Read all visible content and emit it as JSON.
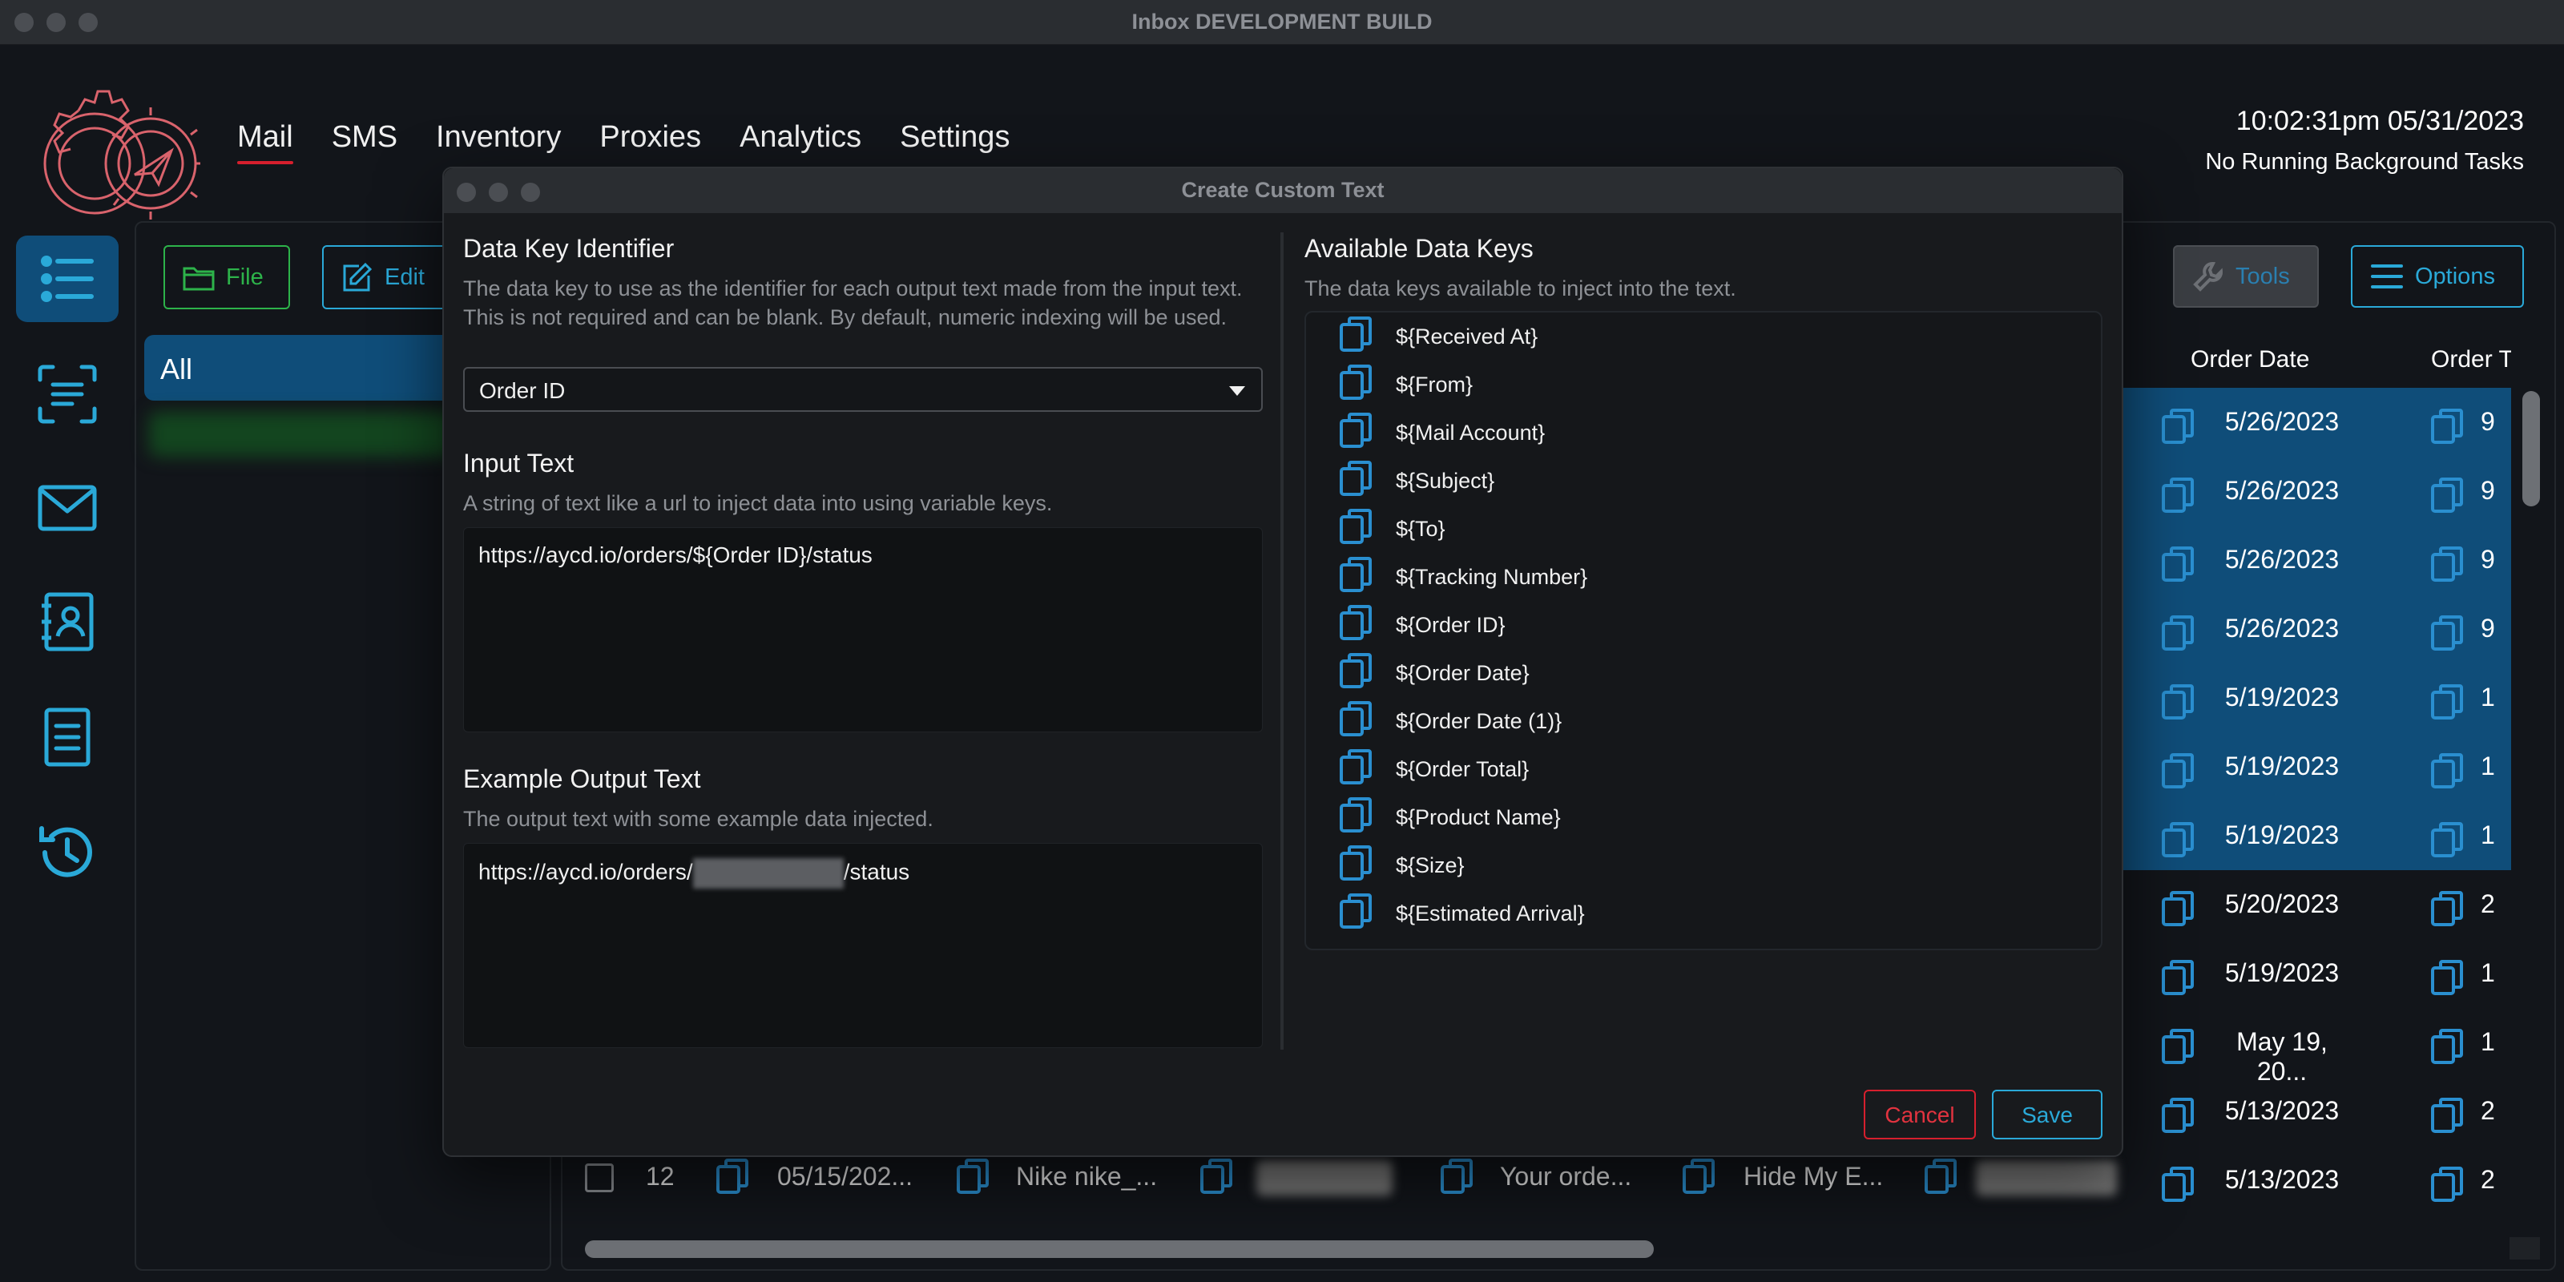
{
  "window": {
    "title": "Inbox DEVELOPMENT BUILD"
  },
  "nav": {
    "items": [
      "Mail",
      "SMS",
      "Inventory",
      "Proxies",
      "Analytics",
      "Settings"
    ],
    "active": "Mail"
  },
  "status": {
    "clock": "10:02:31pm 05/31/2023",
    "background_tasks": "No Running Background Tasks"
  },
  "sidebar": {
    "icons": [
      "list-icon",
      "scan-text-icon",
      "mail-icon",
      "contacts-icon",
      "document-icon",
      "history-icon"
    ]
  },
  "toolbar": {
    "file_label": "File",
    "edit_label": "Edit",
    "tools_label": "Tools",
    "options_label": "Options"
  },
  "folders": {
    "all_label": "All"
  },
  "table": {
    "headers": {
      "order_date": "Order Date",
      "order_total": "Order Tota"
    },
    "rows": [
      {
        "date": "5/26/2023",
        "total": "9",
        "selected": true
      },
      {
        "date": "5/26/2023",
        "total": "9",
        "selected": true
      },
      {
        "date": "5/26/2023",
        "total": "9",
        "selected": true
      },
      {
        "date": "5/26/2023",
        "total": "9",
        "selected": true
      },
      {
        "date": "5/19/2023",
        "total": "1",
        "selected": true
      },
      {
        "date": "5/19/2023",
        "total": "1",
        "selected": true
      },
      {
        "date": "5/19/2023",
        "total": "1",
        "selected": true
      },
      {
        "date": "5/20/2023",
        "total": "2",
        "selected": false
      },
      {
        "date": "5/19/2023",
        "total": "1",
        "selected": false
      },
      {
        "date": "May 19, 20...",
        "total": "1",
        "selected": false
      },
      {
        "date": "5/13/2023",
        "total": "2",
        "selected": false
      },
      {
        "date": "5/13/2023",
        "total": "2",
        "selected": false
      }
    ],
    "bottom_row": {
      "index": "12",
      "date": "05/15/202...",
      "product": "Nike nike_...",
      "subject": "Your orde...",
      "mail": "Hide My E..."
    }
  },
  "modal": {
    "title": "Create Custom Text",
    "data_key": {
      "title": "Data Key Identifier",
      "description": "The data key to use as the identifier for each output text made from the input text. This is not required and can be blank. By default, numeric indexing will be used.",
      "selected": "Order ID"
    },
    "input_text": {
      "title": "Input Text",
      "description": "A string of text like a url to inject data into using variable keys.",
      "value": "https://aycd.io/orders/${Order ID}/status"
    },
    "example_output": {
      "title": "Example Output Text",
      "description": "The output text with some example data injected.",
      "prefix": "https://aycd.io/orders/",
      "suffix": "/status"
    },
    "available_keys": {
      "title": "Available Data Keys",
      "description": "The data keys available to inject into the text.",
      "keys": [
        "${Received At}",
        "${From}",
        "${Mail Account}",
        "${Subject}",
        "${To}",
        "${Tracking Number}",
        "${Order ID}",
        "${Order Date}",
        "${Order Date (1)}",
        "${Order Total}",
        "${Product Name}",
        "${Size}",
        "${Estimated Arrival}"
      ]
    },
    "cancel_label": "Cancel",
    "save_label": "Save"
  }
}
